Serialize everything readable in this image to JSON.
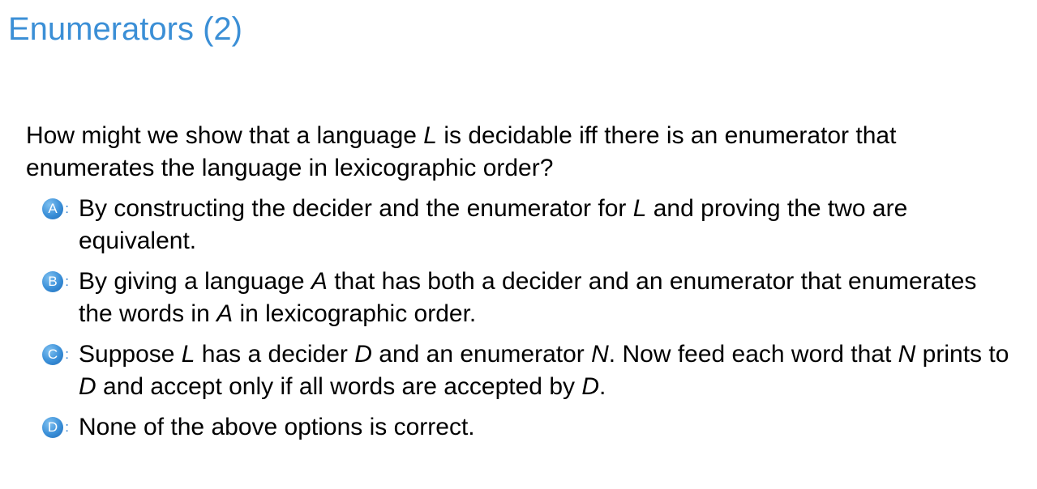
{
  "title": "Enumerators (2)",
  "question": {
    "t1": "How might we show that a language ",
    "m1": "L",
    "t2": " is decidable iff there is an enumerator that enumerates the language in lexicographic order?"
  },
  "options": [
    {
      "letter": "A",
      "t1": "By constructing the decider and the enumerator for ",
      "m1": "L",
      "t2": " and proving the two are equivalent."
    },
    {
      "letter": "B",
      "t1": "By giving a language ",
      "m1": "A",
      "t2": " that has both a decider and an enumerator that enumerates the words in ",
      "m2": "A",
      "t3": " in lexicographic order."
    },
    {
      "letter": "C",
      "t1": "Suppose ",
      "m1": "L",
      "t2": " has a decider ",
      "m2": "D",
      "t3": " and an enumerator ",
      "m3": "N",
      "t4": ". Now feed each word that ",
      "m4": "N",
      "t5": " prints to ",
      "m5": "D",
      "t6": " and accept only if all words are accepted by ",
      "m6": "D",
      "t7": "."
    },
    {
      "letter": "D",
      "t1": "None of the above options is correct."
    }
  ],
  "badge_colon": ":",
  "colors": {
    "title": "#3b8fd6",
    "badge": "#3a8fd8",
    "text": "#000000"
  }
}
